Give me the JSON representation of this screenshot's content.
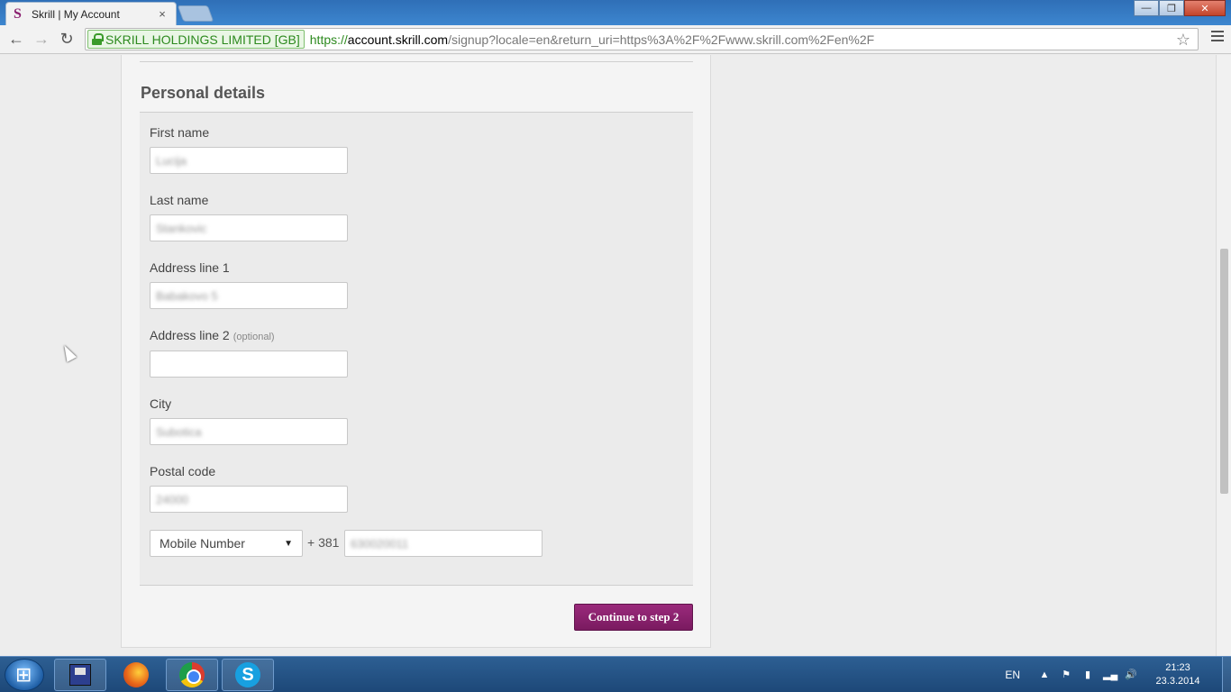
{
  "browser": {
    "tab_title": "Skrill | My Account",
    "tab_favicon": "S",
    "tab_close": "×",
    "ev_badge": "SKRILL HOLDINGS LIMITED [GB]",
    "url_scheme": "https://",
    "url_host": "account.skrill.com",
    "url_path": "/signup?locale=en&return_uri=https%3A%2F%2Fwww.skrill.com%2Fen%2F",
    "back": "←",
    "forward": "→",
    "reload": "↻",
    "star": "☆",
    "win_min": "—",
    "win_max": "❐",
    "win_close": "✕"
  },
  "form": {
    "section_title": "Personal details",
    "first_name": {
      "label": "First name",
      "value": "Lucija"
    },
    "last_name": {
      "label": "Last name",
      "value": "Stankovic"
    },
    "address1": {
      "label": "Address line 1",
      "value": "Babakovo 5"
    },
    "address2": {
      "label": "Address line 2",
      "optional": "(optional)",
      "value": ""
    },
    "city": {
      "label": "City",
      "value": "Subotica"
    },
    "postal_code": {
      "label": "Postal code",
      "value": "24000"
    },
    "phone": {
      "type_selected": "Mobile Number",
      "country_code": "+ 381",
      "value": "630020011"
    },
    "continue_label": "Continue to step 2"
  },
  "taskbar": {
    "language": "EN",
    "time": "21:23",
    "date": "23.3.2014"
  },
  "colors": {
    "brand": "#862165",
    "ev_green": "#2d8a1f"
  },
  "icons": [
    "back-icon",
    "forward-icon",
    "reload-icon",
    "lock-icon",
    "star-icon",
    "menu-icon",
    "select-caret-icon",
    "cursor-icon",
    "save-icon",
    "firefox-icon",
    "chrome-icon",
    "skype-icon"
  ]
}
